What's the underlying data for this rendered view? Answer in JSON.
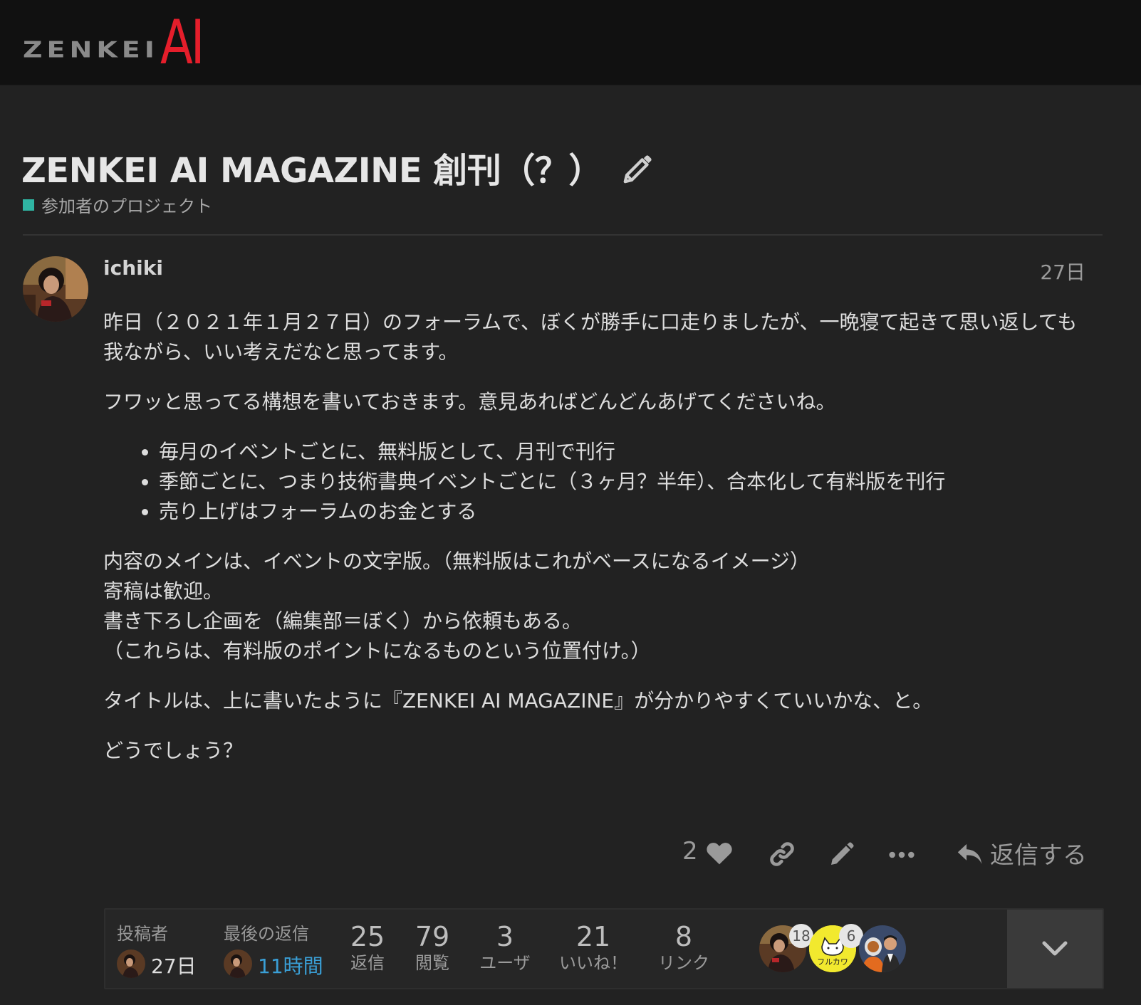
{
  "logo": {
    "word": "ZENKEI",
    "accent": "AI"
  },
  "topic": {
    "title": "ZENKEI AI MAGAZINE 創刊（？）",
    "category": "参加者のプロジェクト",
    "category_color": "#2fb5a3"
  },
  "post": {
    "username": "ichiki",
    "date": "27日",
    "paragraphs": [
      "昨日（２０２１年１月２７日）のフォーラムで、ぼくが勝手に口走りましたが、一晩寝て起きて思い返しても我ながら、いい考えだなと思ってます。",
      "フワッと思ってる構想を書いておきます。意見あればどんどんあげてくださいね。"
    ],
    "bullets": [
      "毎月のイベントごとに、無料版として、月刊で刊行",
      "季節ごとに、つまり技術書典イベントごとに（３ヶ月？半年）、合本化して有料版を刊行",
      "売り上げはフォーラムのお金とする"
    ],
    "content_lines": [
      "内容のメインは、イベントの文字版。（無料版はこれがベースになるイメージ）",
      "寄稿は歓迎。",
      "書き下ろし企画を（編集部＝ぼく）から依頼もある。",
      "（これらは、有料版のポイントになるものという位置付け。）"
    ],
    "title_para": "タイトルは、上に書いたように『ZENKEI AI MAGAZINE』が分かりやすくていいかな、と。",
    "closing": "どうでしょう？",
    "like_count": "2",
    "reply_label": "返信する"
  },
  "summary": {
    "created_label": "投稿者",
    "created_time": "27日",
    "last_reply_label": "最後の返信",
    "last_reply_time": "11時間",
    "last_reply_color": "#3a9fd6",
    "stats": [
      {
        "num": "25",
        "label": "返信"
      },
      {
        "num": "79",
        "label": "閲覧"
      },
      {
        "num": "3",
        "label": "ユーザ"
      },
      {
        "num": "21",
        "label": "いいね！"
      },
      {
        "num": "8",
        "label": "リンク"
      }
    ],
    "participants": [
      {
        "count": "18",
        "avatar": "photo-avatar"
      },
      {
        "count": "6",
        "avatar": "cat-avatar",
        "text": "フルカワ"
      },
      {
        "count": "",
        "avatar": "astronaut-avatar"
      }
    ]
  },
  "icons": [
    "pencil-icon",
    "heart-icon",
    "link-icon",
    "pencil-icon",
    "more-icon",
    "reply-icon",
    "chevron-down-icon"
  ]
}
